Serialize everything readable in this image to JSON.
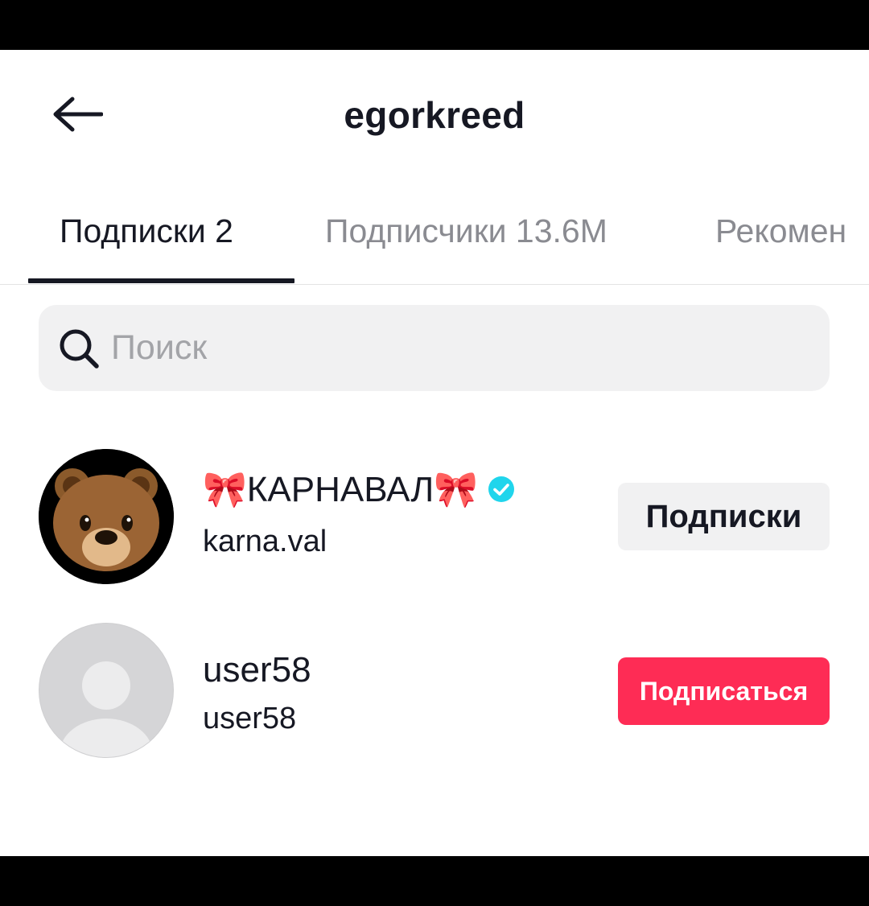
{
  "header": {
    "title": "egorkreed",
    "back_icon": "arrow-left-icon"
  },
  "tabs": [
    {
      "label": "Подписки 2",
      "active": true
    },
    {
      "label": "Подписчики 13.6M",
      "active": false
    },
    {
      "label": "Рекомен",
      "active": false
    }
  ],
  "search": {
    "placeholder": "Поиск",
    "value": "",
    "icon": "search-icon"
  },
  "users": [
    {
      "display_name": "🎀КАРНАВАЛ🎀",
      "username": "karna.val",
      "verified": true,
      "avatar_icon": "bear-avatar-icon",
      "button_label": "Подписки",
      "button_state": "following"
    },
    {
      "display_name": "user58",
      "username": "user58",
      "verified": false,
      "avatar_icon": "default-avatar-icon",
      "button_label": "Подписаться",
      "button_state": "follow"
    }
  ],
  "colors": {
    "accent": "#fe2c55",
    "text": "#161823",
    "muted": "#8a8b91",
    "verified": "#20d5ec"
  }
}
